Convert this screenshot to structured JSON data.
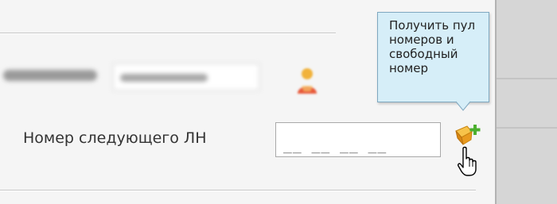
{
  "form": {
    "next_ln_label": "Номер следующего ЛН",
    "next_ln_value": "__ __ __ __"
  },
  "tooltip": {
    "text": "Получить пул номеров и свободный номер"
  },
  "icons": {
    "user": "user-icon",
    "add_pool": "add-pool-icon",
    "cursor": "hand-pointer-cursor-icon"
  },
  "colors": {
    "tooltip_bg": "#d6eef8",
    "tooltip_border": "#7fa8c0",
    "icon_orange": "#f2a72a",
    "icon_green": "#4caf2f"
  }
}
